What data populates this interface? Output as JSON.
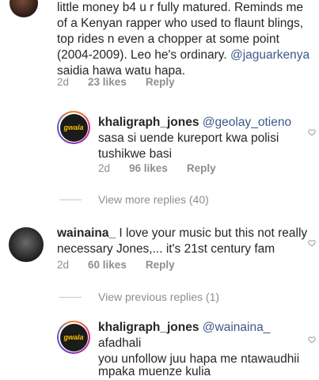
{
  "top_comment": {
    "lines": [
      "little money b4 u r fully matured. Reminds me",
      "of a Kenyan rapper who used to flaunt blings,",
      "top rides n even a chopper at some point",
      "(2004-2009). Leo he's ordinary. "
    ],
    "mention": "@jaguarkenya",
    "last_line": "saidia hawa watu hapa.",
    "time": "2d",
    "likes": "23 likes",
    "reply": "Reply"
  },
  "reply_1": {
    "username": "khaligraph_jones",
    "mention": "@geolay_otieno",
    "line1": "sasa si uende  kureport kwa polisi",
    "line2": "tushikwe basi",
    "time": "2d",
    "likes": "96 likes",
    "reply": "Reply",
    "avatar_text": "gwala"
  },
  "view_more": "View more replies (40)",
  "comment_2": {
    "username": "wainaina_",
    "text1": " I love your music but this not really",
    "text2": "necessary Jones,... it's 21st century fam",
    "time": "2d",
    "likes": "60 likes",
    "reply": "Reply"
  },
  "view_previous": "View previous replies (1)",
  "reply_2": {
    "username": "khaligraph_jones",
    "mention": "@wainaina_",
    "text1_rest": " afadhali",
    "line2": "you unfollow juu hapa me ntawaudhii",
    "line3": "mpaka muenze kulia",
    "avatar_text": "gwala"
  },
  "colors": {
    "text": "#262626",
    "muted": "#8e8e8e",
    "mention": "#3d5a8a"
  }
}
